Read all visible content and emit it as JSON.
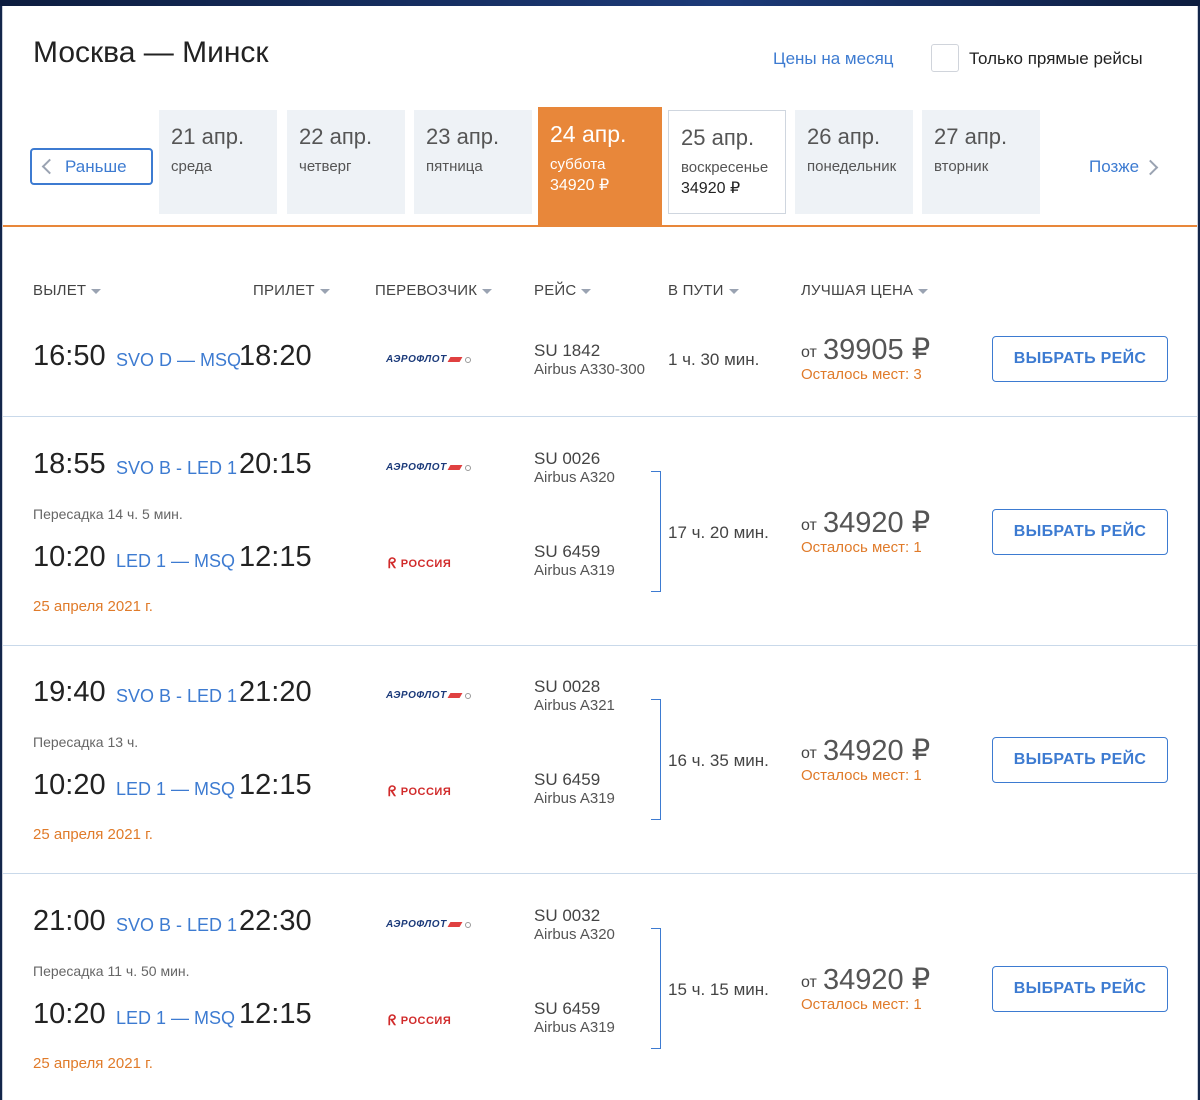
{
  "header": {
    "title": "Москва — Минск",
    "month_prices_link": "Цены на месяц",
    "direct_only_label": "Только прямые рейсы"
  },
  "date_nav": {
    "earlier_label": "Раньше",
    "later_label": "Позже",
    "dates": [
      {
        "date": "21 апр.",
        "weekday": "среда",
        "price": ""
      },
      {
        "date": "22 апр.",
        "weekday": "четверг",
        "price": ""
      },
      {
        "date": "23 апр.",
        "weekday": "пятница",
        "price": ""
      },
      {
        "date": "24 апр.",
        "weekday": "суббота",
        "price": "34920 ₽",
        "selected": true
      },
      {
        "date": "25 апр.",
        "weekday": "воскресенье",
        "price": "34920 ₽"
      },
      {
        "date": "26 апр.",
        "weekday": "понедельник",
        "price": ""
      },
      {
        "date": "27 апр.",
        "weekday": "вторник",
        "price": ""
      }
    ]
  },
  "columns": {
    "departure": "ВЫЛЕТ",
    "arrival": "ПРИЛЕТ",
    "carrier": "ПЕРЕВОЗЧИК",
    "flight": "РЕЙС",
    "duration": "В ПУТИ",
    "best_price": "ЛУЧШАЯ ЦЕНА"
  },
  "flights": [
    {
      "legs": [
        {
          "dep": "16:50",
          "route": "SVO D — MSQ",
          "arr": "18:20",
          "carrier": "АЭРОФЛОТ",
          "flight_no": "SU 1842",
          "aircraft": "Airbus A330-300"
        }
      ],
      "duration": "1 ч. 30 мин.",
      "price_prefix": "от",
      "price": "39905 ₽",
      "seats_left": "Осталось мест: 3",
      "select_label": "ВЫБРАТЬ РЕЙС"
    },
    {
      "legs": [
        {
          "dep": "18:55",
          "route": "SVO B - LED 1",
          "arr": "20:15",
          "carrier": "АЭРОФЛОТ",
          "flight_no": "SU 0026",
          "aircraft": "Airbus A320"
        },
        {
          "dep": "10:20",
          "route": "LED 1 — MSQ",
          "arr": "12:15",
          "carrier": "РОССИЯ",
          "flight_no": "SU 6459",
          "aircraft": "Airbus A319"
        }
      ],
      "transfer": "Пересадка 14 ч. 5 мин.",
      "next_date": "25 апреля 2021 г.",
      "duration": "17 ч. 20 мин.",
      "price_prefix": "от",
      "price": "34920 ₽",
      "seats_left": "Осталось мест: 1",
      "select_label": "ВЫБРАТЬ РЕЙС"
    },
    {
      "legs": [
        {
          "dep": "19:40",
          "route": "SVO B - LED 1",
          "arr": "21:20",
          "carrier": "АЭРОФЛОТ",
          "flight_no": "SU 0028",
          "aircraft": "Airbus A321"
        },
        {
          "dep": "10:20",
          "route": "LED 1 — MSQ",
          "arr": "12:15",
          "carrier": "РОССИЯ",
          "flight_no": "SU 6459",
          "aircraft": "Airbus A319"
        }
      ],
      "transfer": "Пересадка 13 ч.",
      "next_date": "25 апреля 2021 г.",
      "duration": "16 ч. 35 мин.",
      "price_prefix": "от",
      "price": "34920 ₽",
      "seats_left": "Осталось мест: 1",
      "select_label": "ВЫБРАТЬ РЕЙС"
    },
    {
      "legs": [
        {
          "dep": "21:00",
          "route": "SVO B - LED 1",
          "arr": "22:30",
          "carrier": "АЭРОФЛОТ",
          "flight_no": "SU 0032",
          "aircraft": "Airbus A320"
        },
        {
          "dep": "10:20",
          "route": "LED 1 — MSQ",
          "arr": "12:15",
          "carrier": "РОССИЯ",
          "flight_no": "SU 6459",
          "aircraft": "Airbus A319"
        }
      ],
      "transfer": "Пересадка 11 ч. 50 мин.",
      "next_date": "25 апреля 2021 г.",
      "duration": "15 ч. 15 мин.",
      "price_prefix": "от",
      "price": "34920 ₽",
      "seats_left": "Осталось мест: 1",
      "select_label": "ВЫБРАТЬ РЕЙС"
    }
  ]
}
